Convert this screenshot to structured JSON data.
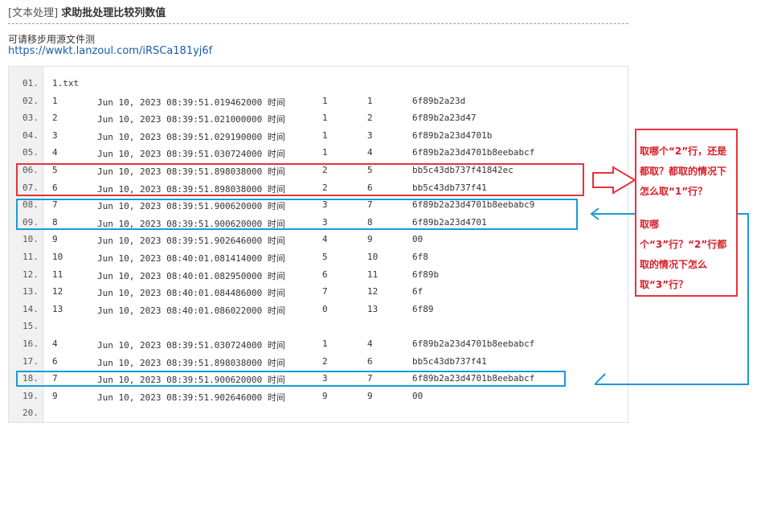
{
  "post": {
    "category": "[文本处理]",
    "title": "求助批处理比较列数值"
  },
  "note": "可请移步用源文件测",
  "link": "https://wwkt.lanzoul.com/iRSCa181yj6f",
  "code_lines": [
    {
      "n": "01.",
      "c": [
        "1.txt",
        "",
        "",
        "",
        ""
      ]
    },
    {
      "n": "02.",
      "c": [
        "1",
        "Jun 10, 2023 08:39:51.019462000 时间",
        "1",
        "1",
        "6f89b2a23d"
      ]
    },
    {
      "n": "03.",
      "c": [
        "2",
        "Jun 10, 2023 08:39:51.021000000 时间",
        "1",
        "2",
        "6f89b2a23d47"
      ]
    },
    {
      "n": "04.",
      "c": [
        "3",
        "Jun 10, 2023 08:39:51.029190000 时间",
        "1",
        "3",
        "6f89b2a23d4701b"
      ]
    },
    {
      "n": "05.",
      "c": [
        "4",
        "Jun 10, 2023 08:39:51.030724000 时间",
        "1",
        "4",
        "6f89b2a23d4701b8eebabcf"
      ]
    },
    {
      "n": "06.",
      "c": [
        "5",
        "Jun 10, 2023 08:39:51.898038000 时间",
        "2",
        "5",
        "bb5c43db737f41842ec"
      ]
    },
    {
      "n": "07.",
      "c": [
        "6",
        "Jun 10, 2023 08:39:51.898038000 时间",
        "2",
        "6",
        "bb5c43db737f41"
      ]
    },
    {
      "n": "08.",
      "c": [
        "7",
        "Jun 10, 2023 08:39:51.900620000 时间",
        "3",
        "7",
        "6f89b2a23d4701b8eebabc9"
      ]
    },
    {
      "n": "09.",
      "c": [
        "8",
        "Jun 10, 2023 08:39:51.900620000 时间",
        "3",
        "8",
        "6f89b2a23d4701"
      ]
    },
    {
      "n": "10.",
      "c": [
        "9",
        "Jun 10, 2023 08:39:51.902646000 时间",
        "4",
        "9",
        "00"
      ]
    },
    {
      "n": "11.",
      "c": [
        "10",
        "Jun 10, 2023 08:40:01.081414000 时间",
        "5",
        "10",
        "6f8"
      ]
    },
    {
      "n": "12.",
      "c": [
        "11",
        "Jun 10, 2023 08:40:01.082950000 时间",
        "6",
        "11",
        "6f89b"
      ]
    },
    {
      "n": "13.",
      "c": [
        "12",
        "Jun 10, 2023 08:40:01.084486000 时间",
        "7",
        "12",
        "6f"
      ]
    },
    {
      "n": "14.",
      "c": [
        "13",
        "Jun 10, 2023 08:40:01.086022000 时间",
        "0",
        "13",
        "6f89"
      ]
    },
    {
      "n": "15.",
      "c": [
        "",
        "",
        "",
        "",
        ""
      ]
    },
    {
      "n": "16.",
      "c": [
        "4",
        "Jun 10, 2023 08:39:51.030724000 时间",
        "1",
        "4",
        "6f89b2a23d4701b8eebabcf"
      ]
    },
    {
      "n": "17.",
      "c": [
        "6",
        "Jun 10, 2023 08:39:51.898038000 时间",
        "2",
        "6",
        "bb5c43db737f41"
      ]
    },
    {
      "n": "18.",
      "c": [
        "7",
        "Jun 10, 2023 08:39:51.900620000 时间",
        "3",
        "7",
        "6f89b2a23d4701b8eebabcf"
      ]
    },
    {
      "n": "19.",
      "c": [
        "9",
        "Jun 10, 2023 08:39:51.902646000 时间",
        "9",
        "9",
        "00"
      ]
    },
    {
      "n": "20.",
      "c": [
        "",
        "",
        "",
        "",
        ""
      ]
    }
  ],
  "annotation": {
    "q1": "取哪个“2”行，还是都取？都取的情况下怎么取“1”行？",
    "q2": "取哪个“3”行？“2”行都取的情况下怎么取“3”行？"
  },
  "colors": {
    "red": "#e8323c",
    "blue": "#1a9ad8",
    "link": "#1a5cb0"
  }
}
